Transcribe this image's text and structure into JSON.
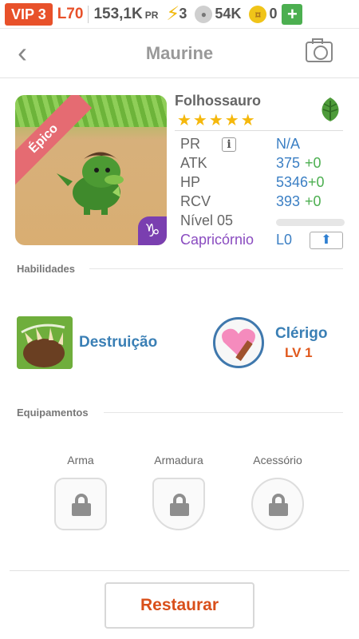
{
  "topbar": {
    "vip": "VIP 3",
    "level": "L70",
    "power": "153,1K",
    "power_unit": "PR",
    "energy": "3",
    "paw_currency": "54K",
    "coins": "0",
    "add_label": "+"
  },
  "header": {
    "title": "Maurine"
  },
  "pet": {
    "rarity": "Épico",
    "species": "Folhossauro",
    "stars": 5,
    "stars_text": "★★★★★",
    "element_icon": "leaf-icon",
    "zodiac_symbol": "♑",
    "stats": {
      "pr_label": "PR",
      "pr_value": "N/A",
      "atk_label": "ATK",
      "atk_value": "375",
      "atk_bonus": "+0",
      "hp_label": "HP",
      "hp_value": "5346",
      "hp_bonus": "+0",
      "rcv_label": "RCV",
      "rcv_value": "393",
      "rcv_bonus": "+0",
      "level_label": "Nível 05",
      "zodiac_label": "Capricórnio",
      "zodiac_level": "L0"
    }
  },
  "sections": {
    "skills_title": "Habilidades",
    "equipment_title": "Equipamentos"
  },
  "skills": [
    {
      "name": "Destruição"
    },
    {
      "name": "Clérigo",
      "level": "LV 1"
    }
  ],
  "equipment": {
    "weapon": "Arma",
    "armor": "Armadura",
    "accessory": "Acessório"
  },
  "actions": {
    "restore": "Restaurar"
  },
  "colors": {
    "accent_orange": "#e8512a",
    "link_blue": "#3a7fb5",
    "bonus_green": "#4caf50",
    "zodiac_purple": "#8a4cc0",
    "star_gold": "#f5b80c"
  }
}
